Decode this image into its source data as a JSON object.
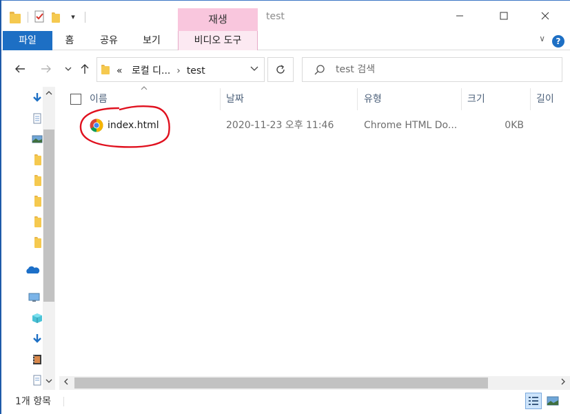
{
  "titlebar": {
    "context_tab_header": "재생",
    "window_title": "test",
    "qat_dropdown": "▾"
  },
  "ribbon": {
    "tabs": [
      {
        "label": "파일"
      },
      {
        "label": "홈"
      },
      {
        "label": "공유"
      },
      {
        "label": "보기"
      },
      {
        "label": "비디오 도구"
      }
    ],
    "help": "?",
    "expand": "∨"
  },
  "address": {
    "breadcrumb_overflow": "«",
    "crumbs": [
      "로컬 디...",
      "test"
    ],
    "separator": "›"
  },
  "search": {
    "placeholder": "test 검색"
  },
  "columns": [
    "이름",
    "날짜",
    "유형",
    "크기",
    "길이"
  ],
  "files": [
    {
      "name": "index.html",
      "date": "2020-11-23 오후 11:46",
      "type": "Chrome HTML Do...",
      "size": "0KB",
      "icon": "chrome-icon"
    }
  ],
  "status": {
    "item_count": "1개 항목"
  },
  "colors": {
    "accent": "#1d6fc4",
    "context_tab": "#f9c6dd",
    "annotation": "#e0101e",
    "header_text": "#4c607a"
  }
}
